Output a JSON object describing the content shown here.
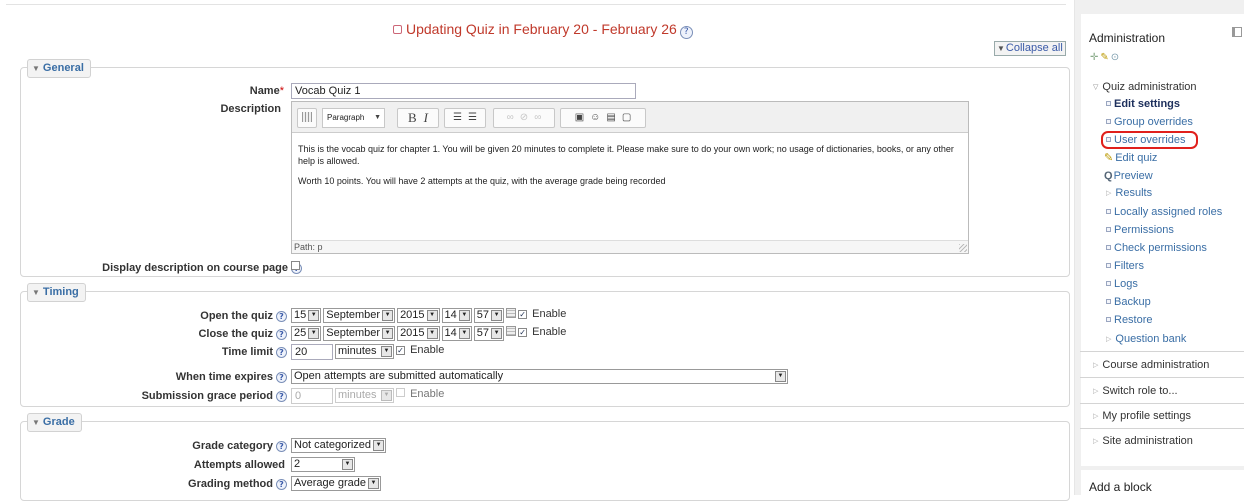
{
  "header": {
    "title": "Updating Quiz in February 20 - February 26",
    "collapse_all": "Collapse all"
  },
  "general": {
    "legend": "General",
    "name_label": "Name",
    "name_required": "*",
    "name_value": "Vocab Quiz 1",
    "description_label": "Description",
    "editor": {
      "paragraph": "Paragraph",
      "content_1": "This is the vocab quiz for chapter 1. You will be given 20 minutes to complete it. Please make sure to do your own work; no usage of dictionaries, books, or any other help is allowed.",
      "content_2": "Worth 10 points. You will have 2 attempts at the quiz, with the average grade being recorded",
      "path": "Path: p"
    },
    "display_desc_label": "Display description on course page"
  },
  "timing": {
    "legend": "Timing",
    "open_label": "Open the quiz",
    "open": {
      "day": "15",
      "month": "September",
      "year": "2015",
      "hour": "14",
      "minute": "57",
      "enable": "Enable"
    },
    "close_label": "Close the quiz",
    "close": {
      "day": "25",
      "month": "September",
      "year": "2015",
      "hour": "14",
      "minute": "57",
      "enable": "Enable"
    },
    "time_limit_label": "Time limit",
    "time_limit_value": "20",
    "time_limit_unit": "minutes",
    "time_limit_enable": "Enable",
    "expires_label": "When time expires",
    "expires_value": "Open attempts are submitted automatically",
    "grace_label": "Submission grace period",
    "grace_value": "0",
    "grace_unit": "minutes",
    "grace_enable": "Enable"
  },
  "grade": {
    "legend": "Grade",
    "category_label": "Grade category",
    "category_value": "Not categorized",
    "attempts_label": "Attempts allowed",
    "attempts_value": "2",
    "method_label": "Grading method",
    "method_value": "Average grade"
  },
  "sidebar": {
    "admin_title": "Administration",
    "quiz_admin": "Quiz administration",
    "items": {
      "edit_settings": "Edit settings",
      "group_overrides": "Group overrides",
      "user_overrides": "User overrides",
      "edit_quiz": "Edit quiz",
      "preview": "Preview",
      "results": "Results",
      "local_roles": "Locally assigned roles",
      "permissions": "Permissions",
      "check_permissions": "Check permissions",
      "filters": "Filters",
      "logs": "Logs",
      "backup": "Backup",
      "restore": "Restore",
      "question_bank": "Question bank"
    },
    "course_admin": "Course administration",
    "switch_role": "Switch role to...",
    "profile_settings": "My profile settings",
    "site_admin": "Site administration",
    "add_block": "Add a block"
  }
}
